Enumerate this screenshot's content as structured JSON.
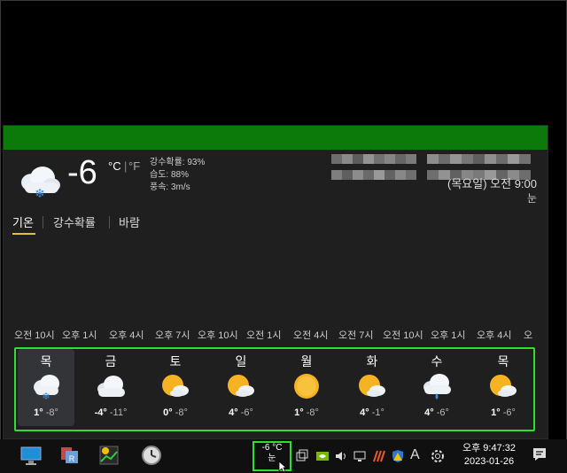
{
  "current": {
    "temp": "-6",
    "unit_c": "°C",
    "unit_sep": "|",
    "unit_f": "°F",
    "precip": "강수확률: 93%",
    "humidity": "습도: 88%",
    "wind": "풍속: 3m/s",
    "location": "(목요일) 오전 9:00",
    "condition": "눈"
  },
  "tabs": [
    "기온",
    "강수확률",
    "바람"
  ],
  "hours": [
    "오전 10시",
    "오후 1시",
    "오후 4시",
    "오후 7시",
    "오후 10시",
    "오전 1시",
    "오전 4시",
    "오전 7시",
    "오전 10시",
    "오후 1시",
    "오후 4시",
    "오"
  ],
  "days": [
    {
      "name": "목",
      "icon": "snow-cloud-icon",
      "hi": "1°",
      "lo": "-8°"
    },
    {
      "name": "금",
      "icon": "cloud-icon",
      "hi": "-4°",
      "lo": "-11°"
    },
    {
      "name": "토",
      "icon": "partly-cloudy-icon",
      "hi": "0°",
      "lo": "-8°"
    },
    {
      "name": "일",
      "icon": "partly-cloudy-icon",
      "hi": "4°",
      "lo": "-6°"
    },
    {
      "name": "월",
      "icon": "sun-icon",
      "hi": "1°",
      "lo": "-8°"
    },
    {
      "name": "화",
      "icon": "partly-cloudy-icon",
      "hi": "4°",
      "lo": "-1°"
    },
    {
      "name": "수",
      "icon": "rain-cloud-icon",
      "hi": "4°",
      "lo": "-6°"
    },
    {
      "name": "목",
      "icon": "partly-cloudy-icon",
      "hi": "1°",
      "lo": "-6°"
    }
  ],
  "taskbar": {
    "weather_temp": "-6 °C",
    "weather_cond": "눈",
    "time": "오후 9:47:32",
    "date": "2023-01-26",
    "ime": "A"
  },
  "colors": {
    "accent": "#0b7a0b",
    "highlight": "#2ee02e",
    "tab_underline": "#e0c23a"
  }
}
